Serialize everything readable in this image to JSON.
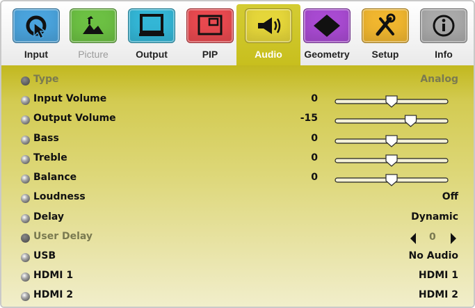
{
  "tabs": [
    {
      "label": "Input",
      "icon": "input-cursor-icon",
      "color": "#4aa3dc",
      "state": "normal"
    },
    {
      "label": "Picture",
      "icon": "picture-landscape-icon",
      "color": "#6cc043",
      "state": "disabled"
    },
    {
      "label": "Output",
      "icon": "output-monitor-icon",
      "color": "#33b6d6",
      "state": "normal"
    },
    {
      "label": "PIP",
      "icon": "pip-window-icon",
      "color": "#e8494f",
      "state": "normal"
    },
    {
      "label": "Audio",
      "icon": "audio-speaker-icon",
      "color": "#e5d63a",
      "state": "active"
    },
    {
      "label": "Geometry",
      "icon": "geometry-diamond-icon",
      "color": "#a84ad1",
      "state": "normal"
    },
    {
      "label": "Setup",
      "icon": "setup-tools-icon",
      "color": "#f0b62f",
      "state": "normal"
    },
    {
      "label": "Info",
      "icon": "info-icon",
      "color": "#a9a9a9",
      "state": "normal"
    }
  ],
  "audio": {
    "type": {
      "label": "Type",
      "value": "Analog"
    },
    "input_volume": {
      "label": "Input Volume",
      "value": "0",
      "level": 0.5
    },
    "output_volume": {
      "label": "Output Volume",
      "value": "-15",
      "level": 0.67
    },
    "bass": {
      "label": "Bass",
      "value": "0",
      "level": 0.5
    },
    "treble": {
      "label": "Treble",
      "value": "0",
      "level": 0.5
    },
    "balance": {
      "label": "Balance",
      "value": "0",
      "level": 0.5
    },
    "loudness": {
      "label": "Loudness",
      "value": "Off"
    },
    "delay": {
      "label": "Delay",
      "value": "Dynamic"
    },
    "user_delay": {
      "label": "User Delay",
      "value": "0"
    },
    "usb": {
      "label": "USB",
      "value": "No Audio"
    },
    "hdmi1": {
      "label": "HDMI 1",
      "value": "HDMI 1"
    },
    "hdmi2": {
      "label": "HDMI 2",
      "value": "HDMI 2"
    }
  },
  "colors": {
    "panel_accent": "#c6bd1b",
    "text_muted": "#7a7a50"
  }
}
